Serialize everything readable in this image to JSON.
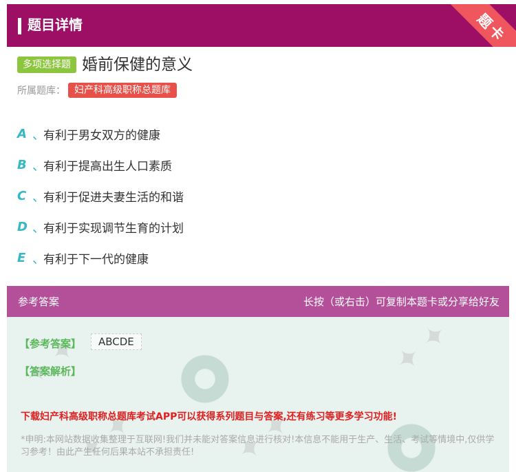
{
  "header": {
    "title": "题目详情",
    "ribbon": "题卡"
  },
  "question": {
    "type_badge": "多项选择题",
    "title": "婚前保健的意义",
    "bank_label": "所属题库：",
    "bank_name": "妇产科高级职称总题库"
  },
  "options": [
    {
      "letter": "A",
      "sep": "、",
      "text": "有利于男女双方的健康"
    },
    {
      "letter": "B",
      "sep": "、",
      "text": "有利于提高出生人口素质"
    },
    {
      "letter": "C",
      "sep": "、",
      "text": "有利于促进夫妻生活的和谐"
    },
    {
      "letter": "D",
      "sep": "、",
      "text": "有利于实现调节生育的计划"
    },
    {
      "letter": "E",
      "sep": "、",
      "text": "有利于下一代的健康"
    }
  ],
  "answer_section": {
    "header_left": "参考答案",
    "header_right": "长按（或右击）可复制本题卡或分享给好友",
    "answer_label": "【参考答案】",
    "answer_value": "ABCDE",
    "analysis_label": "【答案解析】",
    "promo": "下载妇产科高级职称总题库考试APP可以获得系列题目与答案,还有练习等更多学习功能!",
    "disclaimer": "*申明:本网站数据收集整理于互联网!我们并未能对答案信息进行核对!本信息不能用于生产、生活、考试等情境中,仅供学习参考！由此产生任何后果本站不承担责任!"
  },
  "colors": {
    "header_bg": "#9c0f65",
    "ribbon": "#f0565e",
    "type_badge": "#8cc63f",
    "bank_badge": "#e8514a",
    "option_letter": "#36b8c4",
    "answer_header": "#b4509a",
    "answer_body": "#e8f2ee",
    "answer_label": "#5cb85c",
    "promo": "#e02020"
  }
}
